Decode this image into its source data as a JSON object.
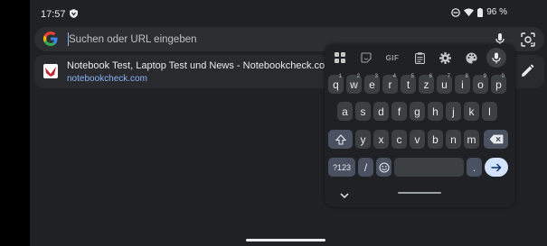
{
  "status": {
    "time": "17:57",
    "battery": "96 %"
  },
  "omnibox": {
    "placeholder": "Suchen oder URL eingeben"
  },
  "suggestion": {
    "title": "Notebook Test, Laptop Test und News - Notebookcheck.com",
    "url": "notebookcheck.com"
  },
  "keyboard": {
    "toolbar": {
      "gif": "GIF"
    },
    "row1": [
      {
        "label": "q",
        "hint": "1"
      },
      {
        "label": "w",
        "hint": "2"
      },
      {
        "label": "e",
        "hint": "3"
      },
      {
        "label": "r",
        "hint": "4"
      },
      {
        "label": "t",
        "hint": "5"
      },
      {
        "label": "z",
        "hint": "6"
      },
      {
        "label": "u",
        "hint": "7"
      },
      {
        "label": "i",
        "hint": "8"
      },
      {
        "label": "o",
        "hint": "9"
      },
      {
        "label": "p",
        "hint": "0"
      }
    ],
    "row2": [
      "a",
      "s",
      "d",
      "f",
      "g",
      "h",
      "j",
      "k",
      "l"
    ],
    "row3": [
      "y",
      "x",
      "c",
      "v",
      "b",
      "n",
      "m"
    ],
    "symbols_label": "?123",
    "slash_label": "/",
    "period_label": "."
  },
  "colors": {
    "background": "#202124",
    "key": "#3c4043",
    "key_dark": "#4a5161",
    "link": "#8ab4f8"
  }
}
